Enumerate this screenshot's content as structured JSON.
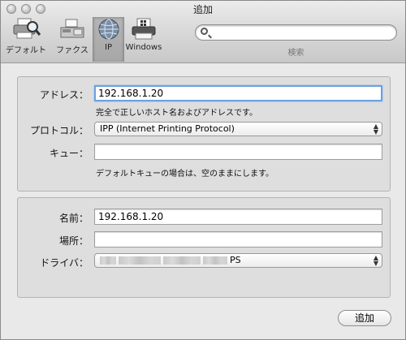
{
  "window": {
    "title": "追加"
  },
  "toolbar": {
    "items": [
      {
        "label": "デフォルト",
        "icon": "printer-magnifier-icon"
      },
      {
        "label": "ファクス",
        "icon": "fax-icon"
      },
      {
        "label": "IP",
        "icon": "globe-icon",
        "selected": true
      },
      {
        "label": "Windows",
        "icon": "windows-printer-icon"
      }
    ],
    "search": {
      "placeholder": "",
      "label": "検索"
    }
  },
  "form": {
    "address_label": "アドレス：",
    "address_value": "192.168.1.20",
    "address_hint": "完全で正しいホスト名およびアドレスです。",
    "protocol_label": "プロトコル：",
    "protocol_value": "IPP (Internet Printing Protocol)",
    "queue_label": "キュー：",
    "queue_value": "",
    "queue_hint": "デフォルトキューの場合は、空のままにします。",
    "name_label": "名前：",
    "name_value": "192.168.1.20",
    "location_label": "場所：",
    "location_value": "",
    "driver_label": "ドライバ：",
    "driver_value_suffix": "PS"
  },
  "actions": {
    "add_label": "追加"
  }
}
